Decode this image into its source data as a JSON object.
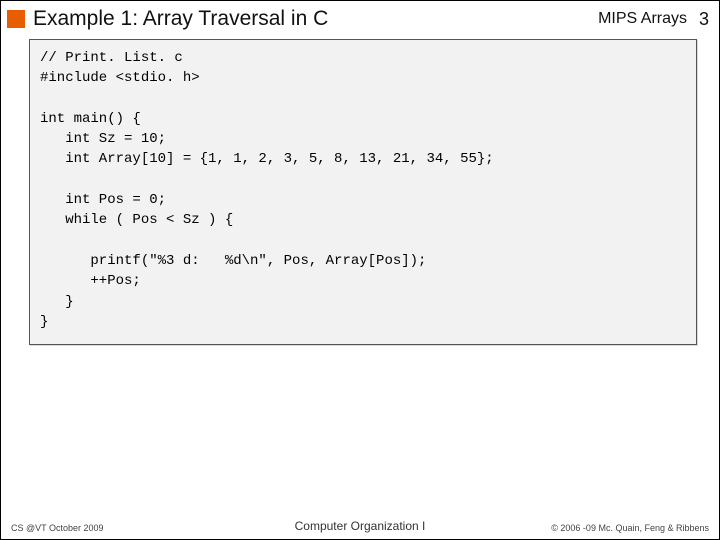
{
  "header": {
    "title": "Example 1: Array Traversal in C",
    "topic": "MIPS Arrays",
    "page_number": "3"
  },
  "code": "// Print. List. c\n#include <stdio. h>\n\nint main() {\n   int Sz = 10;\n   int Array[10] = {1, 1, 2, 3, 5, 8, 13, 21, 34, 55};\n\n   int Pos = 0;\n   while ( Pos < Sz ) {\n\n      printf(\"%3 d:   %d\\n\", Pos, Array[Pos]);\n      ++Pos;\n   }\n}",
  "footer": {
    "left": "CS @VT October 2009",
    "center": "Computer Organization I",
    "right": "© 2006 -09  Mc. Quain, Feng & Ribbens"
  }
}
